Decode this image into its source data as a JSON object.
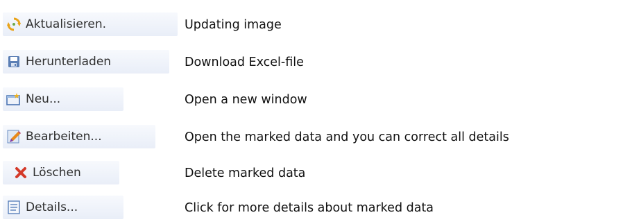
{
  "rows": [
    {
      "icon": "refresh-icon",
      "button_label": "Aktualisieren.",
      "description": "Updating image"
    },
    {
      "icon": "save-disk-icon",
      "button_label": "Herunterladen",
      "description": "Download Excel-file"
    },
    {
      "icon": "new-folder-icon",
      "button_label": "Neu...",
      "description": "Open a new window"
    },
    {
      "icon": "edit-pencil-icon",
      "button_label": "Bearbeiten...",
      "description": "Open the marked data and you can correct all details"
    },
    {
      "icon": "delete-x-icon",
      "button_label": "Löschen",
      "description": "Delete marked data"
    },
    {
      "icon": "details-document-icon",
      "button_label": "Details...",
      "description": "Click for more details about marked data"
    }
  ]
}
